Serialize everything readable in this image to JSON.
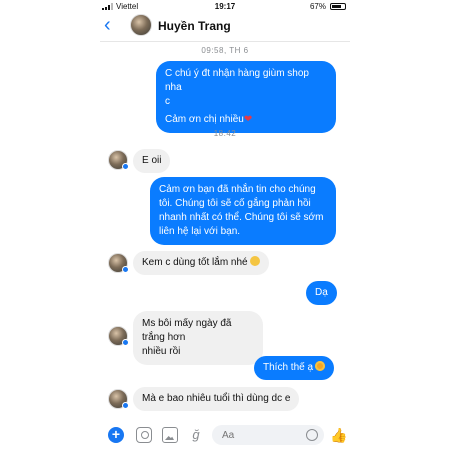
{
  "status_bar": {
    "carrier": "Viettel",
    "time": "19:17",
    "battery": "67%"
  },
  "header": {
    "contact_name": "Huyền Trang"
  },
  "messages": {
    "stamp_1": "09:58, TH 6",
    "m1_line1": "C chú ý đt nhận hàng giùm shop nha",
    "m1_line2": "c",
    "m1_line3": "Cảm ơn chị nhiều",
    "stamp_2": "18:42",
    "m2": "E oii",
    "m3_line1": "Cảm ơn bạn đã nhắn tin cho chúng",
    "m3_line2": "tôi. Chúng tôi sẽ cố gắng phản hồi",
    "m3_line3": "nhanh nhất có thể. Chúng tôi sẽ sớm",
    "m3_line4": "liên hệ lại với bạn.",
    "m4": "Kem c dùng tốt lắm nhé",
    "m5": "Dạ",
    "m6_line1": "Ms bôi mấy ngày đã trắng hơn",
    "m6_line2": "nhiều rồi",
    "m7": "Thích thế ạ",
    "m8": "Mà e bao nhiêu tuổi thì dùng dc e"
  },
  "composer": {
    "placeholder": "Aa"
  },
  "icons": {
    "plus": "plus-icon",
    "camera": "camera-icon",
    "gallery": "gallery-icon",
    "mic": "mic-icon",
    "emoji": "emoji-icon",
    "like": "thumbs-up-icon"
  },
  "colors": {
    "outgoing": "#0a7cff",
    "incoming": "#f0f0f0",
    "accent": "#1877f2"
  }
}
